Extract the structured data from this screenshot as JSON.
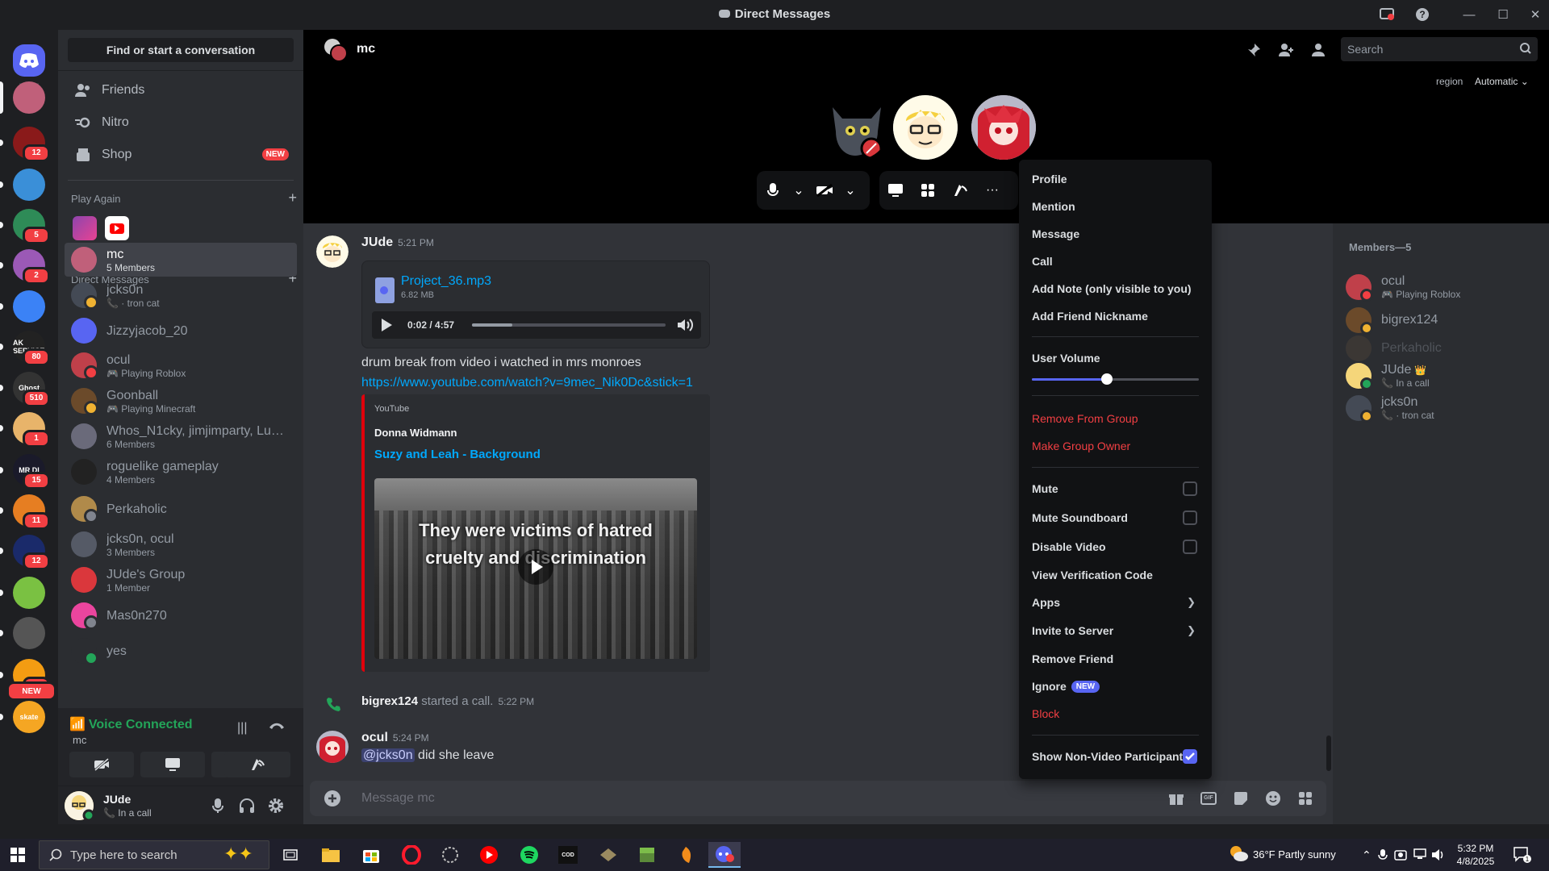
{
  "window": {
    "title": "Direct Messages"
  },
  "servers": [
    {
      "name": "discord-home",
      "color": "#5865f2",
      "badge": ""
    },
    {
      "name": "server-1",
      "color": "#c0607a",
      "badge": ""
    },
    {
      "name": "server-2",
      "color": "#8a1a1a",
      "badge": "12"
    },
    {
      "name": "server-3",
      "color": "#3a8fd8",
      "badge": ""
    },
    {
      "name": "server-4",
      "color": "#2e8b57",
      "badge": "5"
    },
    {
      "name": "server-5",
      "color": "#9b59b6",
      "badge": "2"
    },
    {
      "name": "server-6",
      "color": "#3b82f6",
      "badge": ""
    },
    {
      "name": "server-7",
      "color": "#222222",
      "badge": "80"
    },
    {
      "name": "server-8",
      "color": "#333333",
      "badge": "510"
    },
    {
      "name": "server-9",
      "color": "#e8b46a",
      "badge": "1"
    },
    {
      "name": "server-10",
      "color": "#1a1a2a",
      "badge": "15"
    },
    {
      "name": "server-11",
      "color": "#e67e22",
      "badge": "11"
    },
    {
      "name": "server-12",
      "color": "#1a2a6a",
      "badge": "12"
    },
    {
      "name": "server-13",
      "color": "#7ac142",
      "badge": ""
    },
    {
      "name": "server-14",
      "color": "#555555",
      "badge": ""
    },
    {
      "name": "server-15",
      "color": "#f39c12",
      "badge": "2"
    },
    {
      "name": "server-16",
      "color": "#f5a623",
      "badge": ""
    }
  ],
  "rail_new_badge": "NEW",
  "server_texts": {
    "s7": "AK SERVICE",
    "s8": "Ghost",
    "s10": "MR DI",
    "s16": "skate"
  },
  "sidebar": {
    "find": "Find or start a conversation",
    "nav": [
      {
        "label": "Friends",
        "icon": "friends-icon"
      },
      {
        "label": "Nitro",
        "icon": "nitro-icon"
      },
      {
        "label": "Shop",
        "icon": "shop-icon",
        "badge": "NEW"
      }
    ],
    "play_again": "Play Again",
    "direct_messages": "Direct Messages",
    "dms": [
      {
        "name": "mc",
        "sub": "5 Members",
        "color": "#c0607a",
        "status": ""
      },
      {
        "name": "jcks0n",
        "sub": "📞 · tron cat",
        "color": "#444a55",
        "status": "#f0b232"
      },
      {
        "name": "Jizzyjacob_20",
        "sub": "",
        "color": "#5865f2",
        "status": ""
      },
      {
        "name": "ocul",
        "sub": "🎮 Playing Roblox",
        "color": "#c0404a",
        "status": "#f23f43"
      },
      {
        "name": "Goonball",
        "sub": "🎮 Playing Minecraft",
        "color": "#6b4a2a",
        "status": "#f0b232"
      },
      {
        "name": "Whos_N1cky, jimjimparty, Luc...",
        "sub": "6 Members",
        "color": "#6a6a7a",
        "status": ""
      },
      {
        "name": "roguelike gameplay",
        "sub": "4 Members",
        "color": "#222222",
        "status": ""
      },
      {
        "name": "Perkaholic",
        "sub": "",
        "color": "#b08a4a",
        "status": "#80848e"
      },
      {
        "name": "jcks0n, ocul",
        "sub": "3 Members",
        "color": "#555a66",
        "status": ""
      },
      {
        "name": "JUde's Group",
        "sub": "1 Member",
        "color": "#da373c",
        "status": ""
      },
      {
        "name": "Mas0n270",
        "sub": "",
        "color": "#eb459e",
        "status": "#80848e"
      },
      {
        "name": "yes",
        "sub": "",
        "color": "#2b2d31",
        "status": "#23a559"
      }
    ]
  },
  "voice": {
    "status": "Voice Connected",
    "channel": "mc"
  },
  "user": {
    "name": "JUde",
    "status": "📞 In a call"
  },
  "call": {
    "name": "mc",
    "search_placeholder": "Search",
    "region_label": "region",
    "region_value": "Automatic"
  },
  "messages": {
    "m1": {
      "author": "JUde",
      "time": "5:21 PM",
      "file_name": "Project_36.mp3",
      "file_size": "6.82 MB",
      "audio_time": "0:02 / 4:57",
      "audio_progress": 0.21,
      "text": "drum break from video i watched in mrs monroes",
      "link": "https://www.youtube.com/watch?v=9mec_Nik0Dc&stick=1"
    },
    "embed": {
      "provider": "YouTube",
      "author": "Donna Widmann",
      "title": "Suzy and Leah - Background",
      "thumb_text": "They were victims of hatred cruelty and discrimination"
    },
    "m2": {
      "author": "bigrex124",
      "action": "started a call.",
      "time": "5:22 PM"
    },
    "m3": {
      "author": "ocul",
      "time": "5:24 PM",
      "mention": "@jcks0n",
      "text": "did she leave"
    }
  },
  "composer": {
    "placeholder": "Message mc"
  },
  "members": {
    "header": "Members—5",
    "list": [
      {
        "name": "ocul",
        "sub": "🎮 Playing Roblox",
        "color": "#c0404a",
        "status": "#f23f43"
      },
      {
        "name": "bigrex124",
        "sub": "",
        "color": "#6b4a2a",
        "status": "#f0b232"
      },
      {
        "name": "Perkaholic",
        "sub": "",
        "color": "#5a4a3a",
        "status": ""
      },
      {
        "name": "JUde",
        "sub": "📞 In a call",
        "color": "#f5d67a",
        "status": "#23a559",
        "crown": "👑"
      },
      {
        "name": "jcks0n",
        "sub": "📞 · tron cat",
        "color": "#444a55",
        "status": "#f0b232"
      }
    ]
  },
  "menu": {
    "profile": "Profile",
    "mention": "Mention",
    "message": "Message",
    "call": "Call",
    "add_note": "Add Note (only visible to you)",
    "add_nickname": "Add Friend Nickname",
    "user_volume": "User Volume",
    "volume_level": 0.45,
    "remove_group": "Remove From Group",
    "make_owner": "Make Group Owner",
    "mute": "Mute",
    "mute_soundboard": "Mute Soundboard",
    "disable_video": "Disable Video",
    "verification": "View Verification Code",
    "apps": "Apps",
    "invite": "Invite to Server",
    "remove_friend": "Remove Friend",
    "ignore": "Ignore",
    "ignore_badge": "NEW",
    "block": "Block",
    "show_nonvideo": "Show Non-Video Participants"
  },
  "taskbar": {
    "search_placeholder": "Type here to search",
    "weather": "36°F  Partly sunny",
    "time": "5:32 PM",
    "date": "4/8/2025",
    "notif_count": "1"
  }
}
